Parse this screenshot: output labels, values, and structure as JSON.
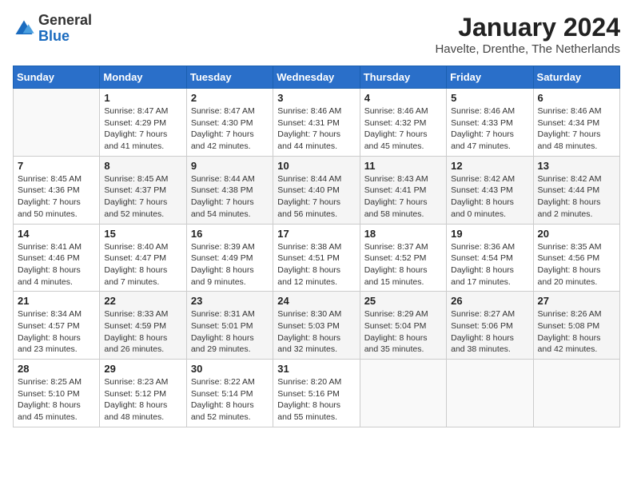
{
  "logo": {
    "general": "General",
    "blue": "Blue"
  },
  "header": {
    "month": "January 2024",
    "location": "Havelte, Drenthe, The Netherlands"
  },
  "weekdays": [
    "Sunday",
    "Monday",
    "Tuesday",
    "Wednesday",
    "Thursday",
    "Friday",
    "Saturday"
  ],
  "weeks": [
    [
      {
        "day": "",
        "info": ""
      },
      {
        "day": "1",
        "info": "Sunrise: 8:47 AM\nSunset: 4:29 PM\nDaylight: 7 hours\nand 41 minutes."
      },
      {
        "day": "2",
        "info": "Sunrise: 8:47 AM\nSunset: 4:30 PM\nDaylight: 7 hours\nand 42 minutes."
      },
      {
        "day": "3",
        "info": "Sunrise: 8:46 AM\nSunset: 4:31 PM\nDaylight: 7 hours\nand 44 minutes."
      },
      {
        "day": "4",
        "info": "Sunrise: 8:46 AM\nSunset: 4:32 PM\nDaylight: 7 hours\nand 45 minutes."
      },
      {
        "day": "5",
        "info": "Sunrise: 8:46 AM\nSunset: 4:33 PM\nDaylight: 7 hours\nand 47 minutes."
      },
      {
        "day": "6",
        "info": "Sunrise: 8:46 AM\nSunset: 4:34 PM\nDaylight: 7 hours\nand 48 minutes."
      }
    ],
    [
      {
        "day": "7",
        "info": "Sunrise: 8:45 AM\nSunset: 4:36 PM\nDaylight: 7 hours\nand 50 minutes."
      },
      {
        "day": "8",
        "info": "Sunrise: 8:45 AM\nSunset: 4:37 PM\nDaylight: 7 hours\nand 52 minutes."
      },
      {
        "day": "9",
        "info": "Sunrise: 8:44 AM\nSunset: 4:38 PM\nDaylight: 7 hours\nand 54 minutes."
      },
      {
        "day": "10",
        "info": "Sunrise: 8:44 AM\nSunset: 4:40 PM\nDaylight: 7 hours\nand 56 minutes."
      },
      {
        "day": "11",
        "info": "Sunrise: 8:43 AM\nSunset: 4:41 PM\nDaylight: 7 hours\nand 58 minutes."
      },
      {
        "day": "12",
        "info": "Sunrise: 8:42 AM\nSunset: 4:43 PM\nDaylight: 8 hours\nand 0 minutes."
      },
      {
        "day": "13",
        "info": "Sunrise: 8:42 AM\nSunset: 4:44 PM\nDaylight: 8 hours\nand 2 minutes."
      }
    ],
    [
      {
        "day": "14",
        "info": "Sunrise: 8:41 AM\nSunset: 4:46 PM\nDaylight: 8 hours\nand 4 minutes."
      },
      {
        "day": "15",
        "info": "Sunrise: 8:40 AM\nSunset: 4:47 PM\nDaylight: 8 hours\nand 7 minutes."
      },
      {
        "day": "16",
        "info": "Sunrise: 8:39 AM\nSunset: 4:49 PM\nDaylight: 8 hours\nand 9 minutes."
      },
      {
        "day": "17",
        "info": "Sunrise: 8:38 AM\nSunset: 4:51 PM\nDaylight: 8 hours\nand 12 minutes."
      },
      {
        "day": "18",
        "info": "Sunrise: 8:37 AM\nSunset: 4:52 PM\nDaylight: 8 hours\nand 15 minutes."
      },
      {
        "day": "19",
        "info": "Sunrise: 8:36 AM\nSunset: 4:54 PM\nDaylight: 8 hours\nand 17 minutes."
      },
      {
        "day": "20",
        "info": "Sunrise: 8:35 AM\nSunset: 4:56 PM\nDaylight: 8 hours\nand 20 minutes."
      }
    ],
    [
      {
        "day": "21",
        "info": "Sunrise: 8:34 AM\nSunset: 4:57 PM\nDaylight: 8 hours\nand 23 minutes."
      },
      {
        "day": "22",
        "info": "Sunrise: 8:33 AM\nSunset: 4:59 PM\nDaylight: 8 hours\nand 26 minutes."
      },
      {
        "day": "23",
        "info": "Sunrise: 8:31 AM\nSunset: 5:01 PM\nDaylight: 8 hours\nand 29 minutes."
      },
      {
        "day": "24",
        "info": "Sunrise: 8:30 AM\nSunset: 5:03 PM\nDaylight: 8 hours\nand 32 minutes."
      },
      {
        "day": "25",
        "info": "Sunrise: 8:29 AM\nSunset: 5:04 PM\nDaylight: 8 hours\nand 35 minutes."
      },
      {
        "day": "26",
        "info": "Sunrise: 8:27 AM\nSunset: 5:06 PM\nDaylight: 8 hours\nand 38 minutes."
      },
      {
        "day": "27",
        "info": "Sunrise: 8:26 AM\nSunset: 5:08 PM\nDaylight: 8 hours\nand 42 minutes."
      }
    ],
    [
      {
        "day": "28",
        "info": "Sunrise: 8:25 AM\nSunset: 5:10 PM\nDaylight: 8 hours\nand 45 minutes."
      },
      {
        "day": "29",
        "info": "Sunrise: 8:23 AM\nSunset: 5:12 PM\nDaylight: 8 hours\nand 48 minutes."
      },
      {
        "day": "30",
        "info": "Sunrise: 8:22 AM\nSunset: 5:14 PM\nDaylight: 8 hours\nand 52 minutes."
      },
      {
        "day": "31",
        "info": "Sunrise: 8:20 AM\nSunset: 5:16 PM\nDaylight: 8 hours\nand 55 minutes."
      },
      {
        "day": "",
        "info": ""
      },
      {
        "day": "",
        "info": ""
      },
      {
        "day": "",
        "info": ""
      }
    ]
  ]
}
